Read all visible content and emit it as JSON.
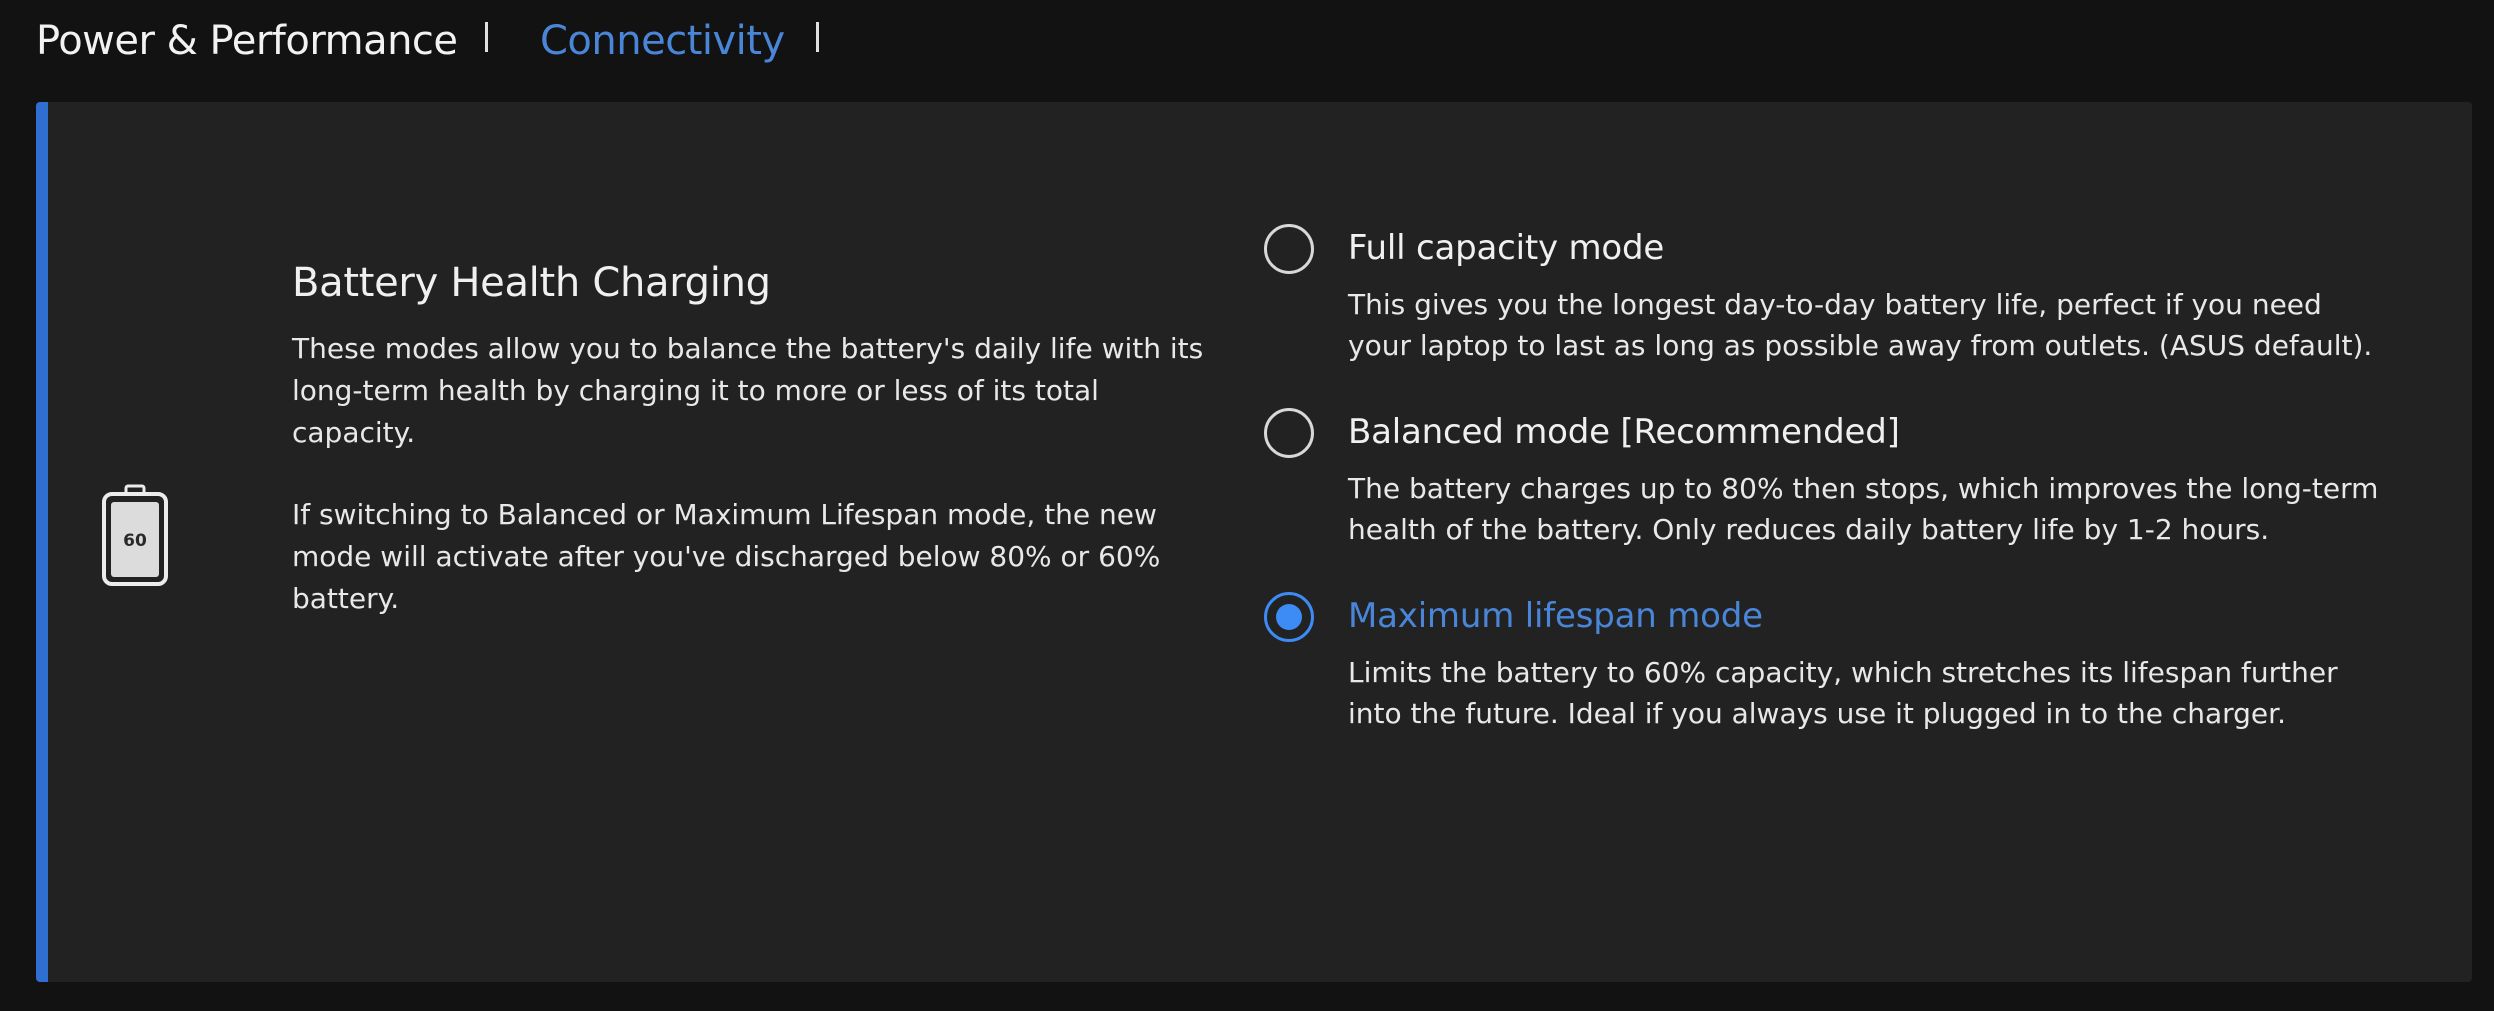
{
  "tabs": [
    {
      "label": "Power & Performance",
      "active": false
    },
    {
      "label": "Connectivity",
      "active": true
    }
  ],
  "colors": {
    "accent": "#2f6fd1",
    "selected_text": "#4a86d8",
    "radio_selected": "#3d8bf5",
    "panel_bg": "#222223",
    "page_bg": "#121212"
  },
  "battery_icon": {
    "icon": "battery-icon",
    "label": "60"
  },
  "section": {
    "title": "Battery Health Charging",
    "description": "These modes allow you to balance the battery's daily life with its long-term health by charging it to more or less of its total capacity.",
    "note": "If switching to Balanced or Maximum Lifespan mode, the new mode will activate after you've discharged below 80% or 60% battery."
  },
  "options": [
    {
      "title": "Full capacity mode",
      "description": "This gives you the longest day-to-day battery life, perfect if you need your laptop to last as long as possible away from outlets. (ASUS default).",
      "selected": false
    },
    {
      "title": "Balanced mode [Recommended]",
      "description": "The battery charges up to 80% then stops, which improves the long-term health of the battery. Only reduces daily battery life by 1-2 hours.",
      "selected": false
    },
    {
      "title": "Maximum lifespan mode",
      "description": "Limits the battery to 60% capacity, which stretches its lifespan further into the future. Ideal if you always use it plugged in to the charger.",
      "selected": true
    }
  ]
}
